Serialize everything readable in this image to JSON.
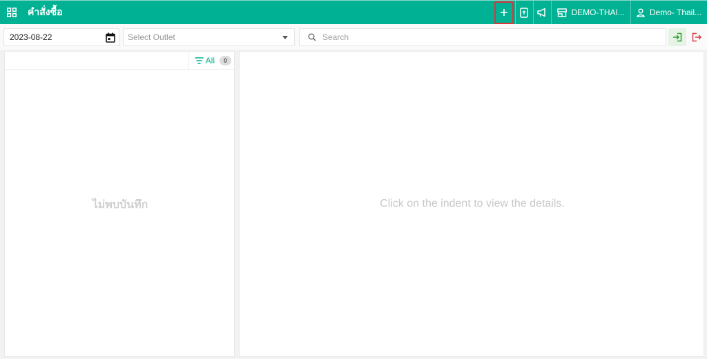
{
  "header": {
    "title": "คำสั่งซื้อ",
    "store_label": "DEMO-THAI...",
    "user_label": "Demo- Thail..."
  },
  "toolbar": {
    "date_value": "2023-08-22",
    "outlet_placeholder": "Select Outlet",
    "search_placeholder": "Search"
  },
  "left_panel": {
    "filter_label": "All",
    "count": "0",
    "empty_text": "ไม่พบบันทึก"
  },
  "right_panel": {
    "empty_text": "Click on the indent to view the details."
  },
  "colors": {
    "brand": "#00b193",
    "highlight_border": "#d9363e",
    "login_green": "#2e9e2e",
    "logout_red": "#d9363e"
  }
}
